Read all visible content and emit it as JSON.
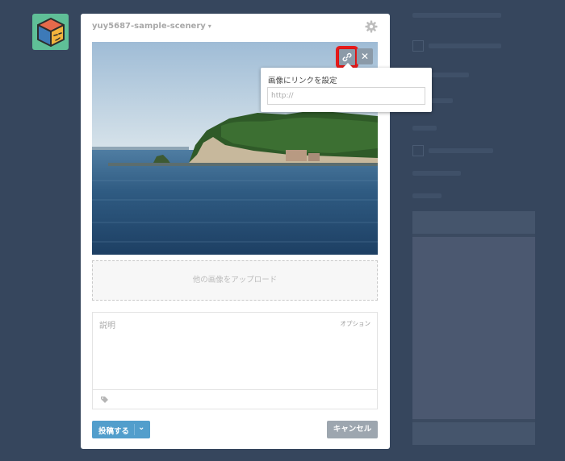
{
  "blog": {
    "name": "yuy5687-sample-scenery",
    "caret": "▾"
  },
  "icons": {
    "avatar": "cube-face-icon",
    "settings": "gear-icon",
    "link": "link-icon",
    "close": "close-icon",
    "tag": "tag-icon",
    "dropdown": "chevron-down-icon"
  },
  "photo": {
    "close_glyph": "✕"
  },
  "link_popup": {
    "title": "画像にリンクを設定",
    "placeholder": "http://",
    "value": ""
  },
  "upload": {
    "label": "他の画像をアップロード"
  },
  "description": {
    "placeholder": "説明",
    "optional": "オプション"
  },
  "actions": {
    "post_label": "投稿する",
    "post_chevron": "⌄",
    "cancel_label": "キャンセル"
  },
  "colors": {
    "background": "#36465d",
    "primary": "#529ecc",
    "cancel": "#9da6af",
    "highlight": "#e41a1a",
    "avatar": "#5fbf97"
  }
}
